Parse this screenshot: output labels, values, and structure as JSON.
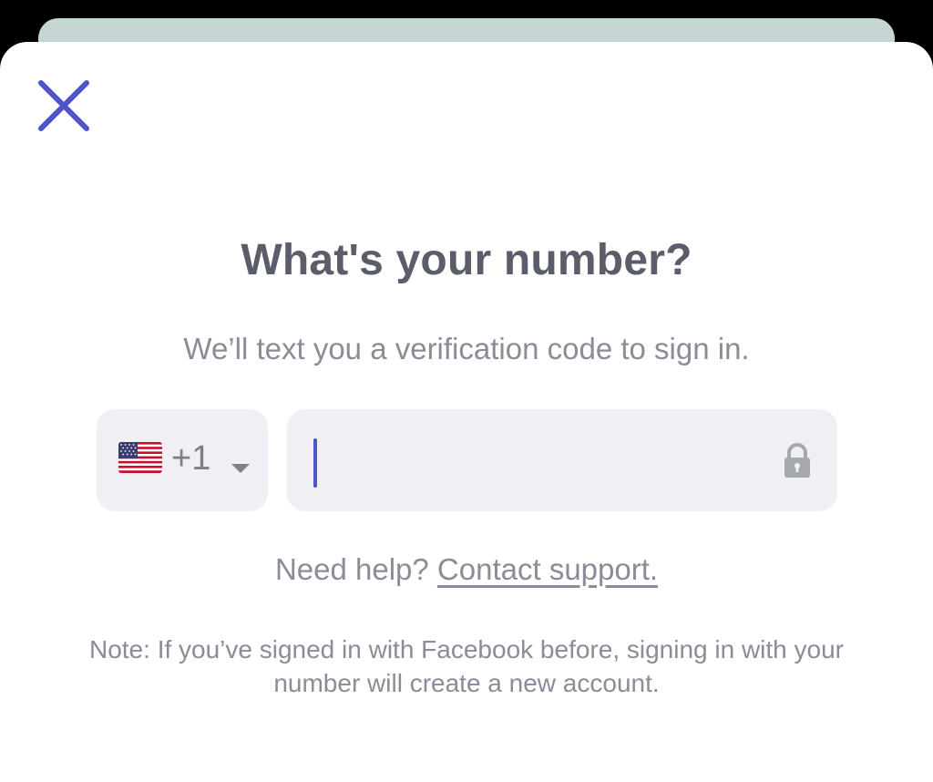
{
  "colors": {
    "accent": "#4f53cc",
    "title_text": "#5b5d6b",
    "secondary_text": "#8a8c97",
    "field_background": "#f0f0f4",
    "sheet_behind": "#c4d6d3"
  },
  "header": {
    "close_icon": "close-icon"
  },
  "content": {
    "title": "What's your number?",
    "subtitle": "We’ll text you a verification code to sign in."
  },
  "phone_form": {
    "country": {
      "flag_icon": "us-flag-icon",
      "dial_code": "+1",
      "dropdown_icon": "chevron-down-icon"
    },
    "number_input": {
      "value": "",
      "placeholder": "",
      "lock_icon": "lock-icon"
    }
  },
  "help": {
    "prefix": "Need help? ",
    "link_label": "Contact support."
  },
  "note": "Note: If you’ve signed in with Facebook before, signing in with your number will create a new account."
}
